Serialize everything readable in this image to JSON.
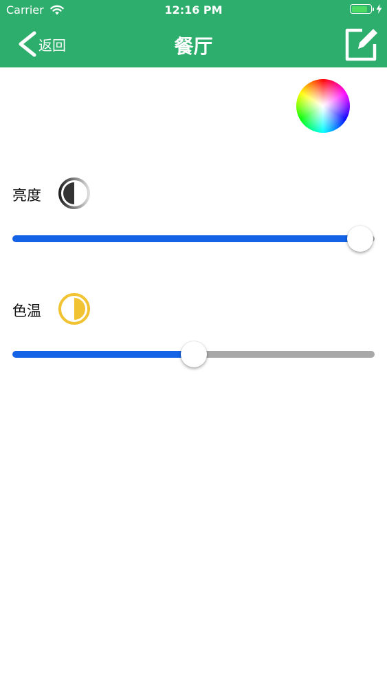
{
  "status_bar": {
    "carrier": "Carrier",
    "time": "12:16 PM",
    "battery_percent": 85,
    "icons": [
      "wifi-icon",
      "battery-icon",
      "charging-bolt-icon"
    ]
  },
  "nav": {
    "back_label": "返回",
    "title": "餐厅",
    "icons": [
      "chevron-left-icon",
      "edit-icon"
    ]
  },
  "color_wheel": {
    "icon": "color-wheel-icon"
  },
  "brightness": {
    "label": "亮度",
    "icon": "brightness-icon",
    "value": 0.96
  },
  "color_temperature": {
    "label": "色温",
    "icon": "color-temperature-icon",
    "value": 0.5
  },
  "colors": {
    "bar": "#2eae6c",
    "slider_fill": "#1462e6",
    "slider_track": "#a8a8a8",
    "temperature_icon": "#f1c232",
    "brightness_icon": "#444444"
  }
}
